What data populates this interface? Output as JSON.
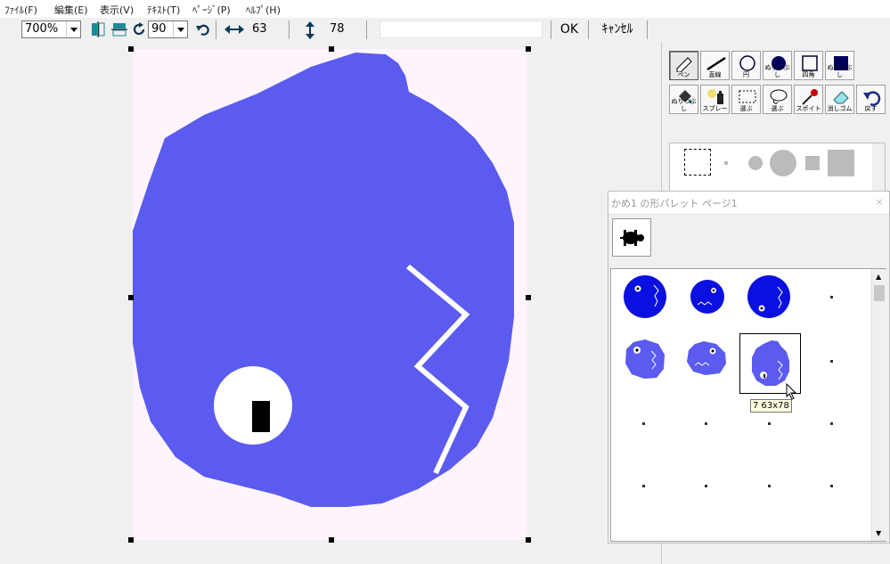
{
  "menu": [
    {
      "label": "ﾌｧｲﾙ(F)"
    },
    {
      "label": "編集(E)"
    },
    {
      "label": "表示(V)"
    },
    {
      "label": "ﾃｷｽﾄ(T)"
    },
    {
      "label": "ﾍﾟｰｼﾞ(P)"
    },
    {
      "label": "ﾍﾙﾌﾟ(H)"
    }
  ],
  "toolbar": {
    "zoom_value": "700%",
    "rotate_value": "90",
    "width_value": "63",
    "height_value": "78",
    "status_text": "",
    "ok_label": "OK",
    "cancel_label": "ｷｬﾝｾﾙ"
  },
  "tools": [
    {
      "label": "ペン",
      "icon": "pen-icon"
    },
    {
      "label": "直線",
      "icon": "line-icon"
    },
    {
      "label": "円",
      "icon": "circle-icon"
    },
    {
      "label": "ぬりつぶし",
      "icon": "filled-circle-icon"
    },
    {
      "label": "四角",
      "icon": "rectangle-icon"
    },
    {
      "label": "ぬりつぶし",
      "icon": "filled-rectangle-icon"
    },
    {
      "label": "ぬりつぶし",
      "icon": "paint-bucket-icon"
    },
    {
      "label": "スプレー",
      "icon": "spray-icon"
    },
    {
      "label": "選ぶ",
      "icon": "rect-select-icon"
    },
    {
      "label": "選ぶ",
      "icon": "lasso-select-icon"
    },
    {
      "label": "スポイト",
      "icon": "eyedropper-icon"
    },
    {
      "label": "消しゴム",
      "icon": "eraser-icon"
    },
    {
      "label": "戻す",
      "icon": "undo-icon"
    }
  ],
  "palette": {
    "title": "かめ1 の形パレット ページ1",
    "close": "×",
    "tooltip": "7 63x78"
  },
  "colors": {
    "fill": "#5b5bf0",
    "fill_dark": "#0a10e0",
    "canvas_bg": "#fdf4fd"
  }
}
